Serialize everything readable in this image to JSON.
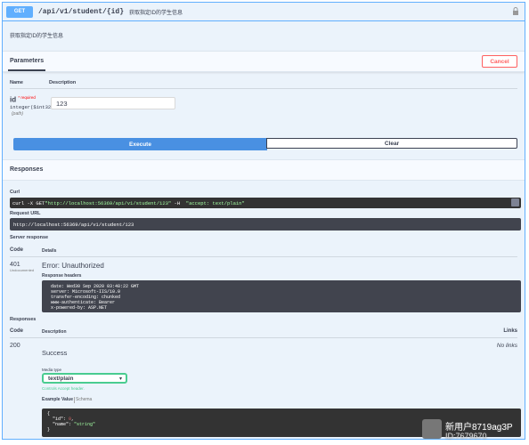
{
  "summary": {
    "method": "GET",
    "path": "/api/v1/student/{id}",
    "description": "获取指定ID的学生信息"
  },
  "description": "获取指定ID的学生信息",
  "parameters_tab": {
    "title": "Parameters",
    "cancel_label": "Cancel",
    "col_name": "Name",
    "col_description": "Description"
  },
  "parameter": {
    "name": "id",
    "required": "* required",
    "type": "integer($int32)",
    "in": "(path)",
    "value": "123"
  },
  "buttons": {
    "execute": "Execute",
    "clear": "Clear"
  },
  "responses_section": {
    "title": "Responses",
    "curl_label": "Curl",
    "curl_prefix": "curl -X GET ",
    "curl_url": "\"http://localhost:56369/api/v1/student/123\"",
    "curl_mid": " -H  ",
    "curl_header": "\"accept: text/plain\"",
    "request_url_label": "Request URL",
    "request_url": "http://localhost:56369/api/v1/student/123",
    "server_response_label": "Server response",
    "col_code": "Code",
    "col_details": "Details",
    "status_code": "401",
    "undocumented": "Undocumented",
    "status_text": "Error: Unauthorized",
    "response_headers_label": "Response headers",
    "response_headers": " date: Wed30 Sep 2020 03:48:22 GMT\n server: Microsoft-IIS/10.0\n transfer-encoding: chunked\n www-authenticate: Bearer\n x-powered-by: ASP.NET"
  },
  "documented": {
    "title": "Responses",
    "col_code": "Code",
    "col_description": "Description",
    "col_links": "Links",
    "code": "200",
    "description": "Success",
    "links": "No links",
    "media_type_label": "Media type",
    "media_type": "text/plain",
    "accept_note": "Controls Accept header.",
    "example_value_tab": "Example Value",
    "schema_tab": "Schema"
  },
  "example": {
    "open": "{",
    "id_key": "  \"id\": ",
    "id_val": "0",
    "name_key": "  \"name\": ",
    "name_val": "\"string\"",
    "close": "}"
  },
  "watermark": {
    "line1": "新用户8719ag3P",
    "line2": "ID:7679670"
  },
  "colors": {
    "get": "#61affe",
    "execute": "#4990e2",
    "cancel": "#ff6060",
    "success": "#49cc90"
  }
}
